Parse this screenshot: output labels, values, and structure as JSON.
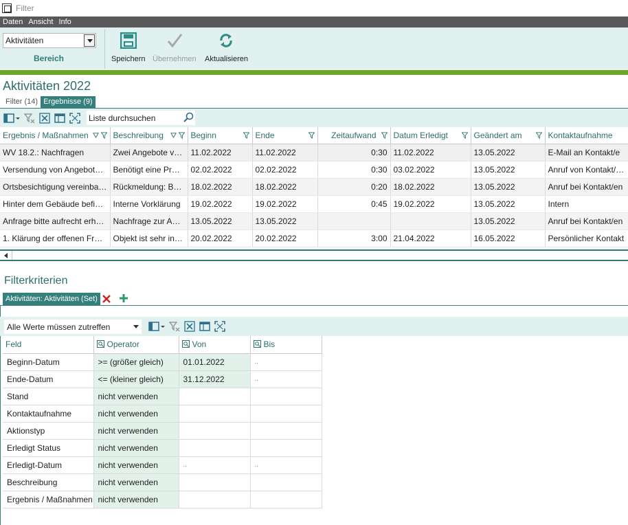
{
  "window": {
    "title": "Filter"
  },
  "menu": [
    "Daten",
    "Ansicht",
    "Info"
  ],
  "ribbon": {
    "bereich_value": "Aktivitäten",
    "bereich_label": "Bereich",
    "save_label": "Speichern",
    "apply_label": "Übernehmen",
    "refresh_label": "Aktualisieren"
  },
  "section": {
    "title": "Aktivitäten 2022",
    "tab_filter": "Filter (14)",
    "tab_results": "Ergebnisse (9)"
  },
  "search": {
    "placeholder": "Liste durchsuchen"
  },
  "results": {
    "columns": [
      "Ergebnis / Maßnahmen",
      "Beschreibung",
      "Beginn",
      "Ende",
      "Zeitaufwand",
      "Datum Erledigt",
      "Geändert am",
      "Kontaktaufnahme"
    ],
    "rows": [
      [
        "WV 18.2.: Nachfragen",
        "Zwei Angebote ve...",
        "11.02.2022",
        "11.02.2022",
        "0:30",
        "11.02.2022",
        "13.05.2022",
        "E-Mail an Kontakt/e"
      ],
      [
        "Versendung von Angeboten...",
        "Benötigt eine Prod...",
        "02.02.2022",
        "02.02.2022",
        "0:30",
        "03.02.2022",
        "13.05.2022",
        "Anruf von Kontakt/en"
      ],
      [
        "Ortsbesichtigung vereinbart...",
        "Rückmeldung: Ba...",
        "18.02.2022",
        "18.02.2022",
        "0:20",
        "18.02.2022",
        "13.05.2022",
        "Anruf bei Kontakt/en"
      ],
      [
        "Hinter dem Gebäude befind...",
        "Interne Vorklärung",
        "19.02.2022",
        "19.02.2022",
        "0:45",
        "19.02.2022",
        "13.05.2022",
        "Intern"
      ],
      [
        "Anfrage bitte aufrecht erhalt...",
        "Nachfrage zur Akt...",
        "13.05.2022",
        "13.05.2022",
        "",
        "",
        "13.05.2022",
        "Anruf bei Kontakt/en"
      ],
      [
        "1. Klärung der offenen Frag...",
        "Objekt ist sehr inte...",
        "20.02.2022",
        "20.02.2022",
        "3:00",
        "21.04.2022",
        "16.05.2022",
        "Persönlicher Kontakt"
      ]
    ]
  },
  "filter": {
    "title": "Filterkriterien",
    "set_tab": "Aktivitäten: Aktivitäten (Set)",
    "mode": "Alle Werte müssen zutreffen",
    "columns": [
      "Feld",
      "Operator",
      "Von",
      "Bis"
    ],
    "rows": [
      [
        "Beginn-Datum",
        ">= (größer gleich)",
        "01.01.2022",
        ".."
      ],
      [
        "Ende-Datum",
        "<= (kleiner gleich)",
        "31.12.2022",
        ".."
      ],
      [
        "Stand",
        "nicht verwenden",
        "",
        ""
      ],
      [
        "Kontaktaufnahme",
        "nicht verwenden",
        "",
        ""
      ],
      [
        "Aktionstyp",
        "nicht verwenden",
        "",
        ""
      ],
      [
        "Erledigt Status",
        "nicht verwenden",
        "",
        ""
      ],
      [
        "Erledigt-Datum",
        "nicht verwenden",
        "..",
        ".."
      ],
      [
        "Beschreibung",
        "nicht verwenden",
        "",
        ""
      ],
      [
        "Ergebnis / Maßnahmen",
        "nicht verwenden",
        "",
        ""
      ]
    ]
  },
  "colors": {
    "teal": "#35807c",
    "ribbon_bg": "#e0f1ef",
    "green_bar": "#6fa629",
    "menu_bg": "#595959"
  }
}
